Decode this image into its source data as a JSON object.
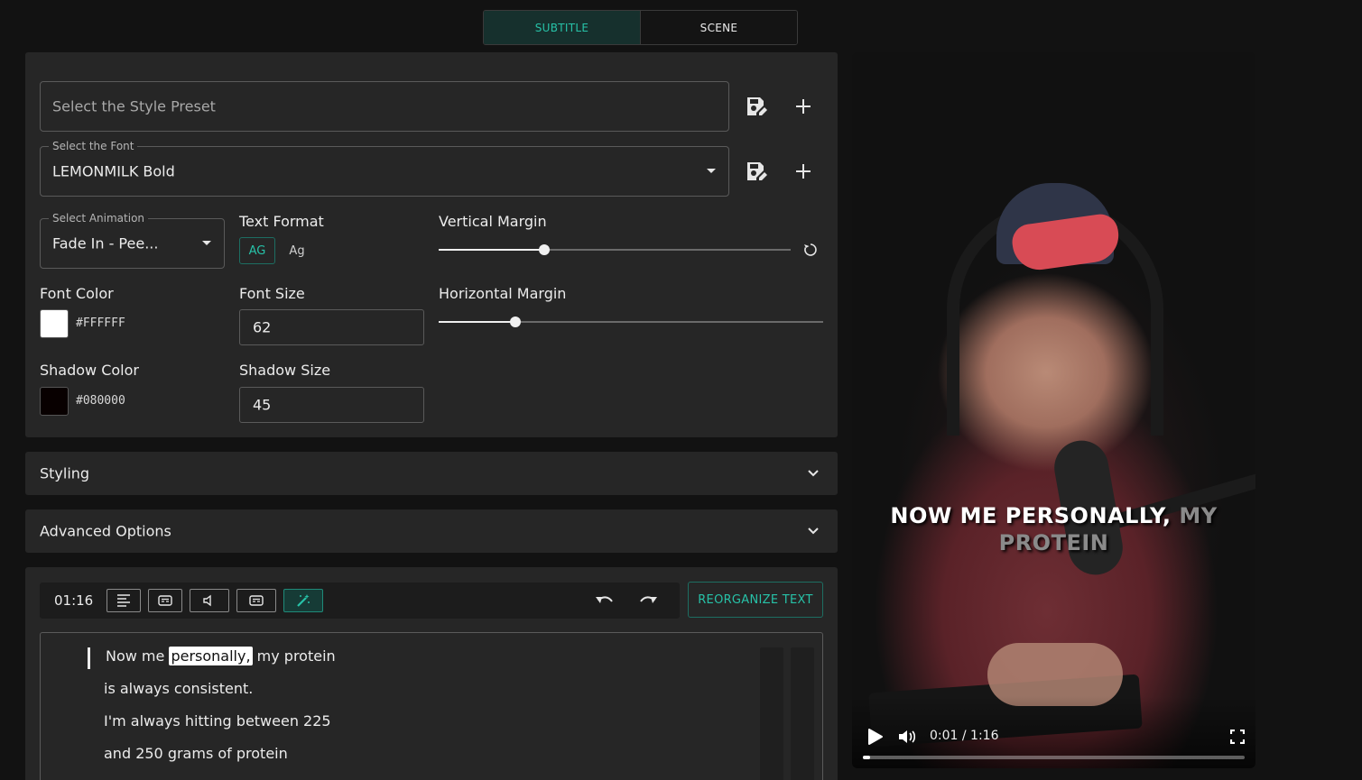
{
  "tabs": [
    {
      "label": "SUBTITLE",
      "active": true
    },
    {
      "label": "SCENE",
      "active": false
    }
  ],
  "style_preset": {
    "placeholder": "Select the Style Preset"
  },
  "font_select": {
    "legend": "Select the Font",
    "value": "LEMONMILK Bold"
  },
  "animation_select": {
    "legend": "Select Animation",
    "value": "Fade In - Pee..."
  },
  "text_format": {
    "label": "Text Format",
    "uppercase": "AG",
    "capitalize": "Ag"
  },
  "vertical_margin": {
    "label": "Vertical Margin",
    "value_fraction": 0.3
  },
  "horizontal_margin": {
    "label": "Horizontal Margin",
    "value_fraction": 0.2
  },
  "font_color": {
    "label": "Font Color",
    "hex": "#FFFFFF"
  },
  "font_size": {
    "label": "Font Size",
    "value": "62"
  },
  "shadow_color": {
    "label": "Shadow Color",
    "hex": "#080000"
  },
  "shadow_size": {
    "label": "Shadow Size",
    "value": "45"
  },
  "sections": {
    "styling": "Styling",
    "advanced": "Advanced Options"
  },
  "editor": {
    "duration": "01:16",
    "reorganize_label": "REORGANIZE TEXT",
    "lines": [
      {
        "before": "Now me",
        "highlight": "personally,",
        "after": "my protein"
      },
      {
        "text": "is always consistent."
      },
      {
        "text": "I'm always hitting between 225"
      },
      {
        "text": "and 250 grams of protein"
      }
    ]
  },
  "video": {
    "subtitle_active": "NOW ME PERSONALLY,",
    "subtitle_next1": "MY",
    "subtitle_next2": "PROTEIN",
    "time": "0:01 / 1:16",
    "progress_fraction": 0.018
  },
  "colors": {
    "accent": "#27c2a8",
    "panel": "#262626",
    "background": "#121212"
  }
}
